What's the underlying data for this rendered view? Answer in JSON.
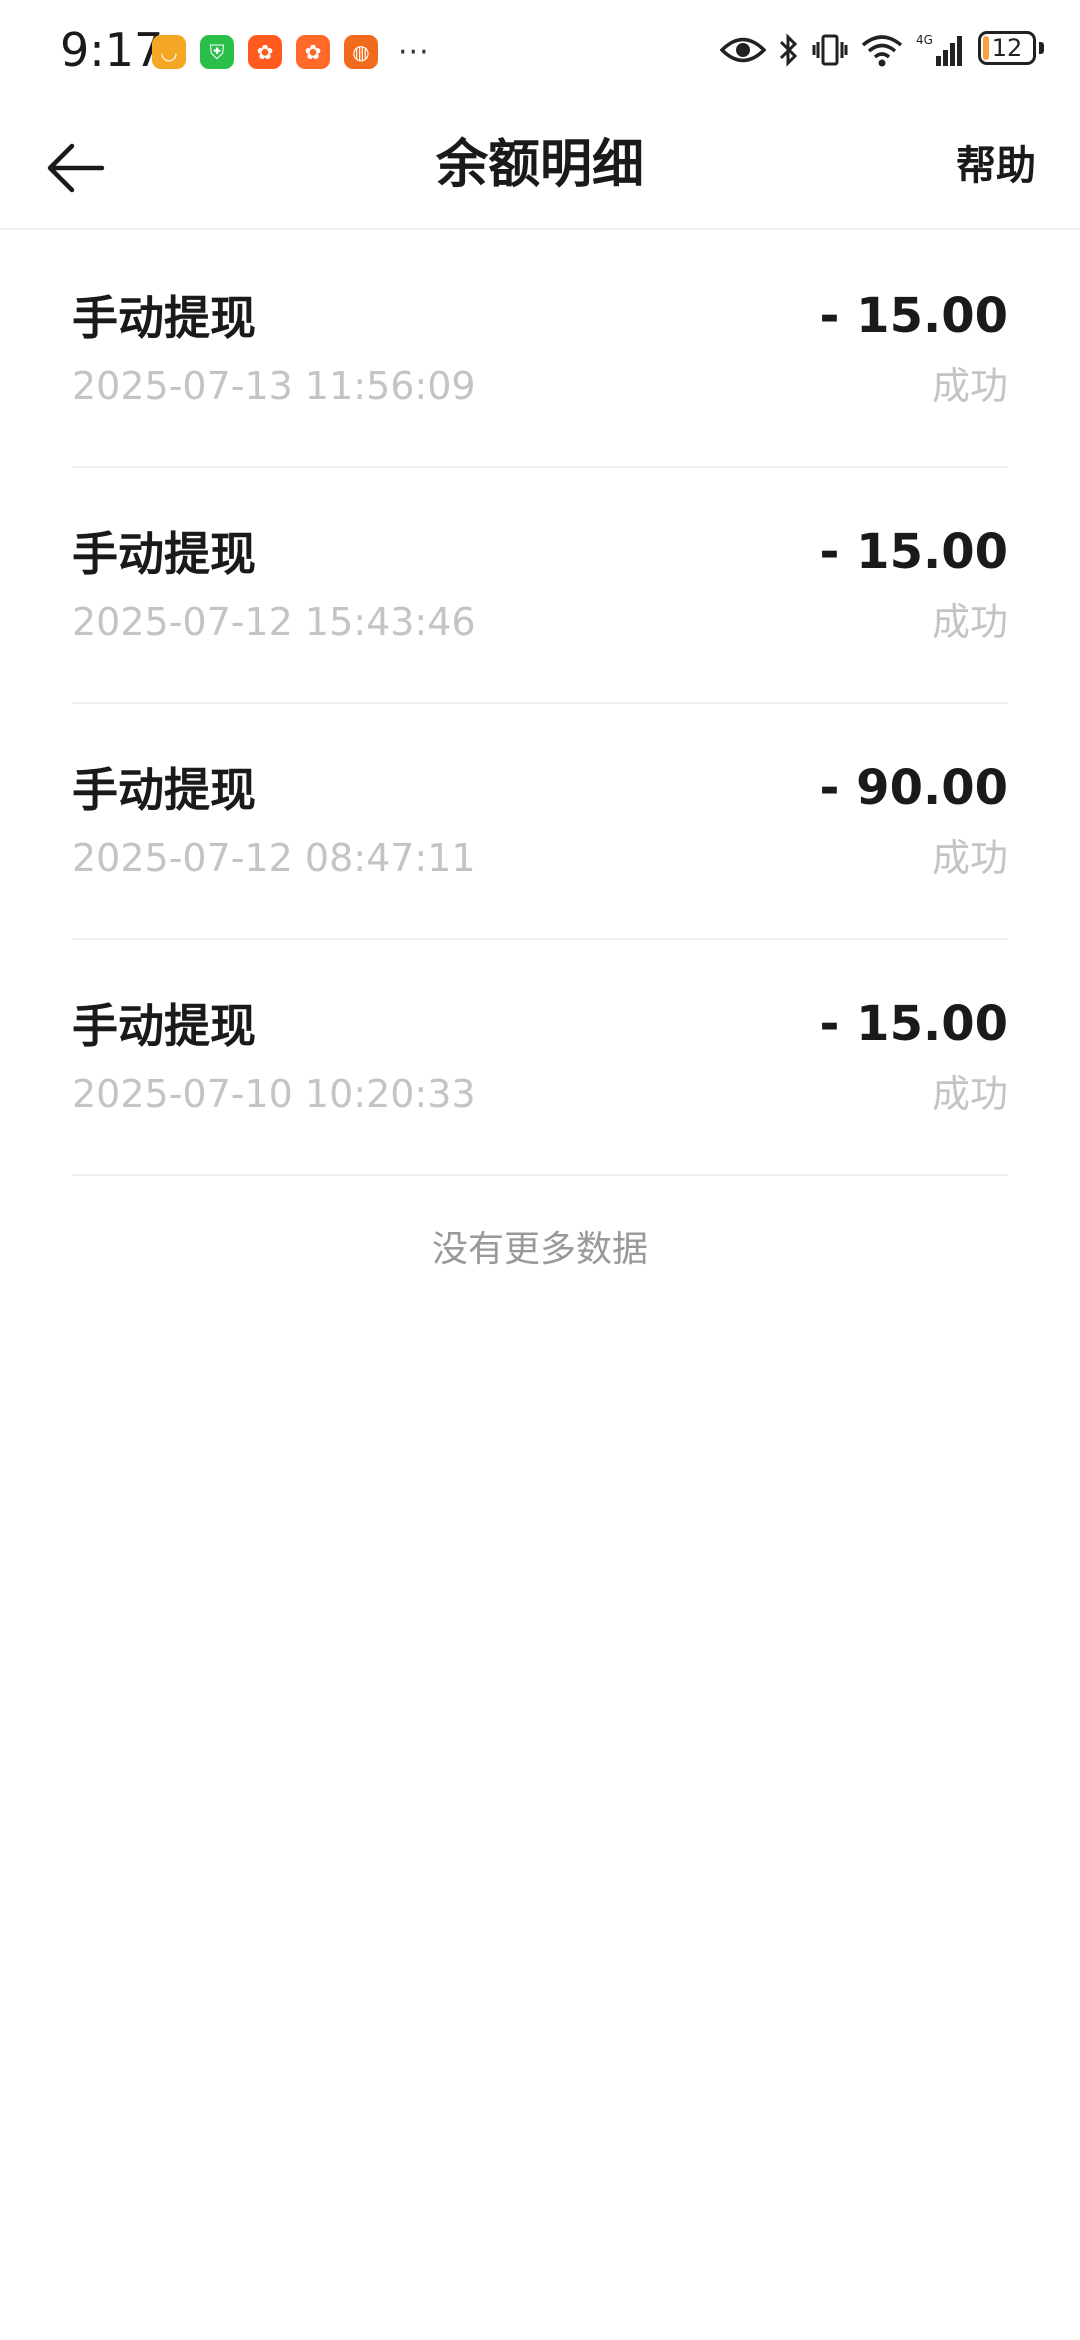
{
  "status_bar": {
    "time": "9:17",
    "battery_level": "12",
    "battery_fraction": 0.12,
    "app_icons": [
      {
        "name": "shopping-app-icon",
        "color": "#f5a623"
      },
      {
        "name": "security-app-icon",
        "color": "#2bbf4a"
      },
      {
        "name": "kuaishou-app-icon",
        "color": "#ff5b1f"
      },
      {
        "name": "kuaishou-lite-app-icon",
        "color": "#ff6a2a"
      },
      {
        "name": "browser-app-icon",
        "color": "#f26a1b"
      }
    ],
    "more_indicator": "···"
  },
  "header": {
    "title": "余额明细",
    "help_label": "帮助"
  },
  "transactions": [
    {
      "title": "手动提现",
      "time": "2025-07-13 11:56:09",
      "amount": "- 15.00",
      "status": "成功"
    },
    {
      "title": "手动提现",
      "time": "2025-07-12 15:43:46",
      "amount": "- 15.00",
      "status": "成功"
    },
    {
      "title": "手动提现",
      "time": "2025-07-12 08:47:11",
      "amount": "- 90.00",
      "status": "成功"
    },
    {
      "title": "手动提现",
      "time": "2025-07-10 10:20:33",
      "amount": "- 15.00",
      "status": "成功"
    }
  ],
  "footer": {
    "end_text": "没有更多数据"
  }
}
